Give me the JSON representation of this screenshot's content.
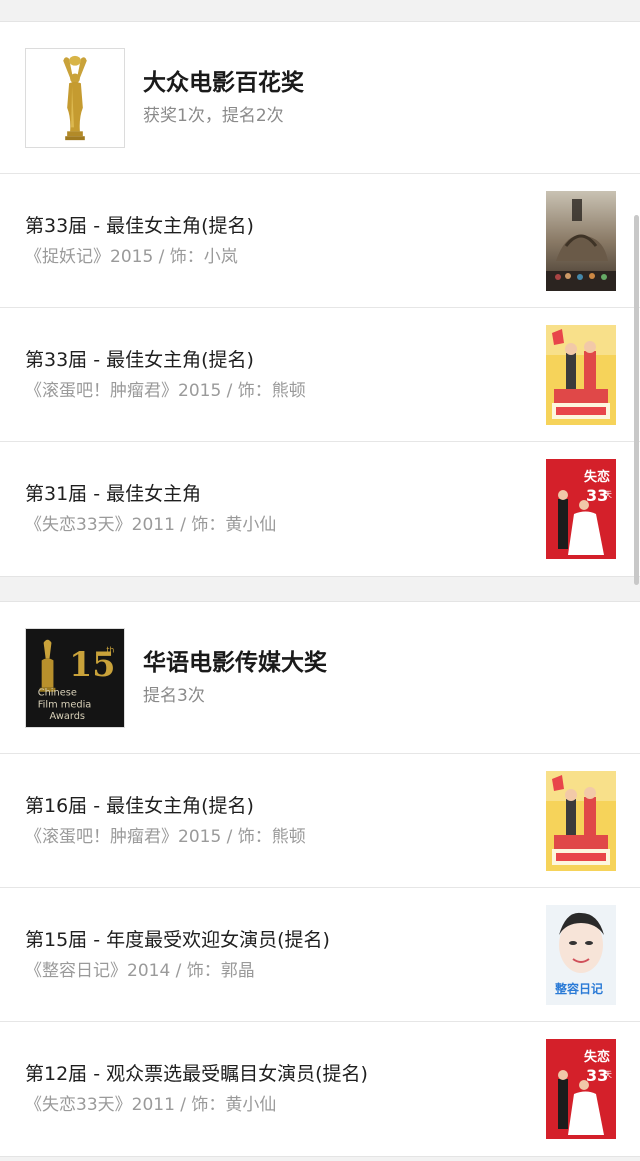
{
  "awards": [
    {
      "name": "大众电影百花奖",
      "summary": "获奖1次，提名2次",
      "logo_icon": "golden-trophy-icon",
      "entries": [
        {
          "title": "第33届 - 最佳女主角(提名)",
          "meta": "《捉妖记》2015 / 饰：小岚",
          "poster": "monster-hunt-poster"
        },
        {
          "title": "第33届 - 最佳女主角(提名)",
          "meta": "《滚蛋吧！肿瘤君》2015 / 饰：熊顿",
          "poster": "go-away-mr-tumor-poster"
        },
        {
          "title": "第31届 - 最佳女主角",
          "meta": "《失恋33天》2011 / 饰：黄小仙",
          "poster": "love-is-not-blind-poster"
        }
      ]
    },
    {
      "name": "华语电影传媒大奖",
      "summary": "提名3次",
      "logo_icon": "chinese-film-media-awards-15-logo",
      "logo_text": {
        "number": "15",
        "suffix": "th",
        "line1": "Chinese",
        "line2": "Film media",
        "line3": "Awards"
      },
      "entries": [
        {
          "title": "第16届 - 最佳女主角(提名)",
          "meta": "《滚蛋吧！肿瘤君》2015 / 饰：熊顿",
          "poster": "go-away-mr-tumor-poster"
        },
        {
          "title": "第15届 - 年度最受欢迎女演员(提名)",
          "meta": "《整容日记》2014 / 饰：郭晶",
          "poster": "facelift-diary-poster",
          "poster_text": "整容日记"
        },
        {
          "title": "第12届 - 观众票选最受瞩目女演员(提名)",
          "meta": "《失恋33天》2011 / 饰：黄小仙",
          "poster": "love-is-not-blind-poster"
        }
      ]
    }
  ],
  "poster_texts": {
    "love_title": "失恋",
    "love_days": "33",
    "love_tian": "天"
  }
}
